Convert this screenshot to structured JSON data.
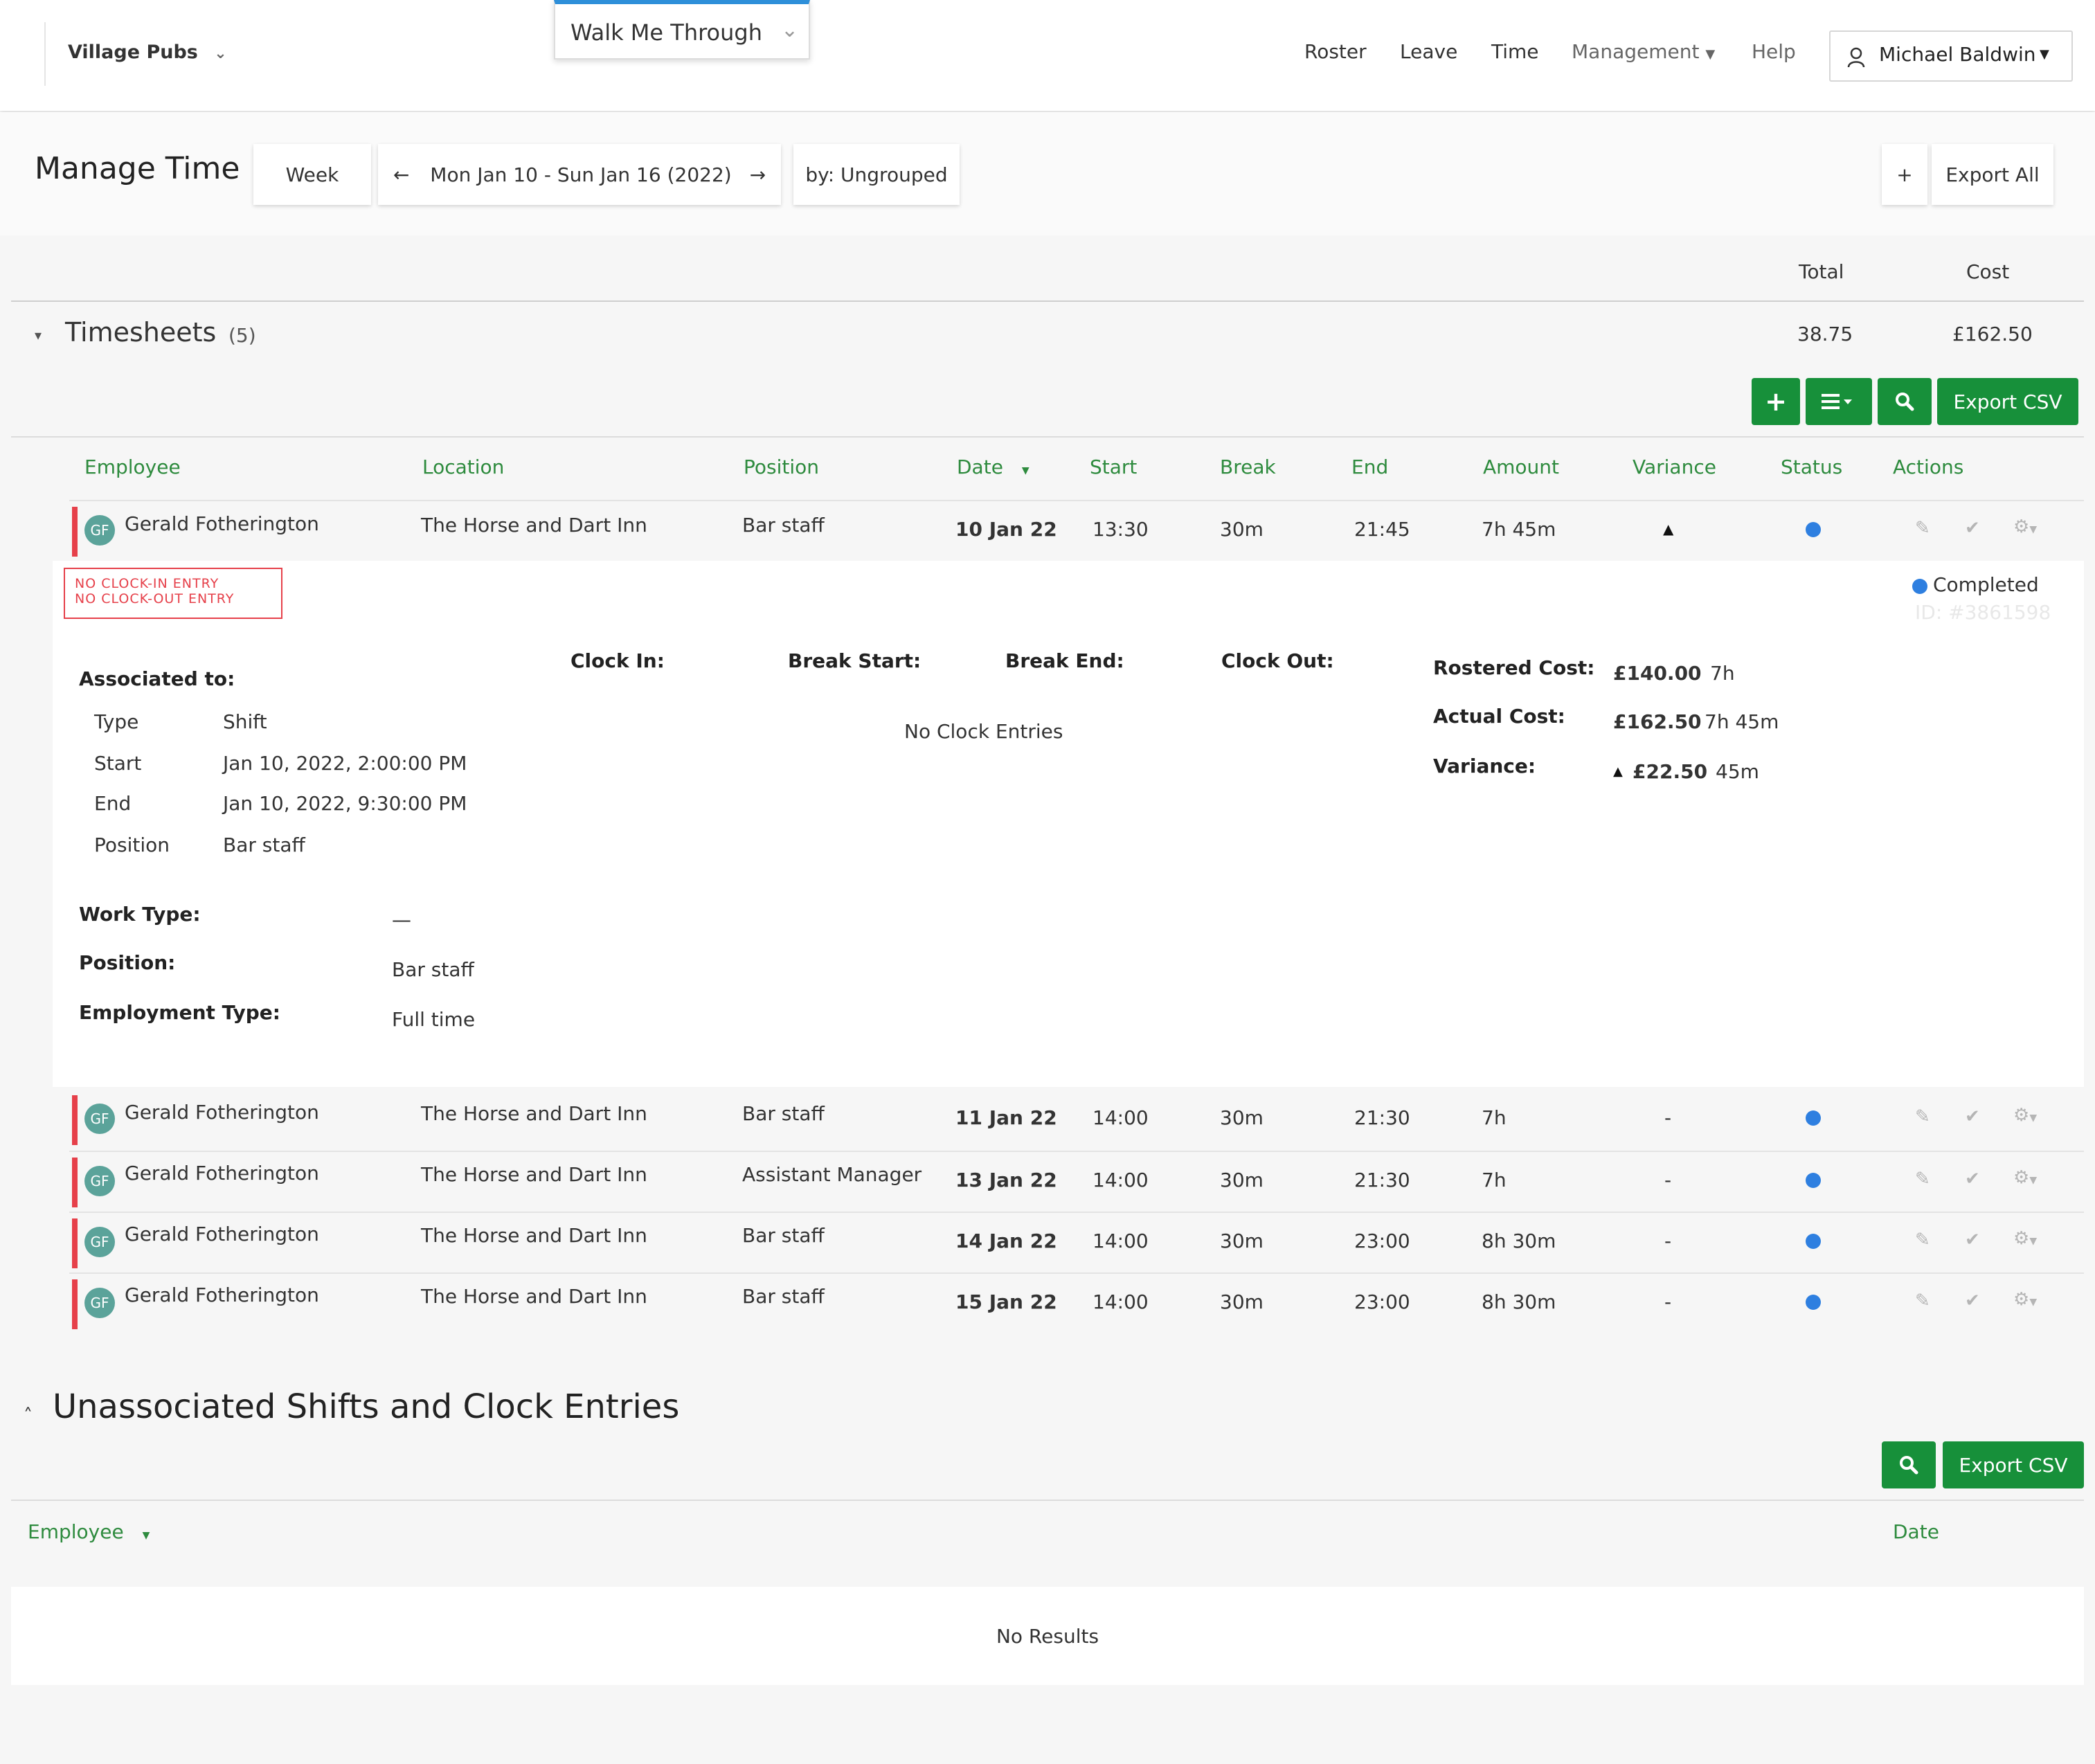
{
  "nav": {
    "org": "Village Pubs",
    "walkme": "Walk Me Through",
    "links": [
      "Roster",
      "Leave",
      "Time",
      "Management",
      "Help"
    ],
    "user": "Michael Baldwin"
  },
  "header": {
    "title": "Manage Time",
    "period": "Week",
    "range": "Mon Jan 10 - Sun Jan 16 (2022)",
    "grouping": "by: Ungrouped",
    "plus": "+",
    "export_all": "Export All"
  },
  "summary": {
    "total_label": "Total",
    "cost_label": "Cost",
    "section": "Timesheets",
    "count": "(5)",
    "total": "38.75",
    "cost": "£162.50"
  },
  "toolbar": {
    "export_csv": "Export CSV"
  },
  "columns": [
    "Employee",
    "Location",
    "Position",
    "Date",
    "Start",
    "Break",
    "End",
    "Amount",
    "Variance",
    "Status",
    "Actions"
  ],
  "rows": [
    {
      "initials": "GF",
      "employee": "Gerald Fotherington",
      "location": "The Horse and Dart Inn",
      "position": "Bar staff",
      "date": "10 Jan 22",
      "start": "13:30",
      "break": "30m",
      "end": "21:45",
      "amount": "7h 45m",
      "variance": "▲"
    },
    {
      "initials": "GF",
      "employee": "Gerald Fotherington",
      "location": "The Horse and Dart Inn",
      "position": "Bar staff",
      "date": "11 Jan 22",
      "start": "14:00",
      "break": "30m",
      "end": "21:30",
      "amount": "7h",
      "variance": "-"
    },
    {
      "initials": "GF",
      "employee": "Gerald Fotherington",
      "location": "The Horse and Dart Inn",
      "position": "Assistant Manager",
      "date": "13 Jan 22",
      "start": "14:00",
      "break": "30m",
      "end": "21:30",
      "amount": "7h",
      "variance": "-"
    },
    {
      "initials": "GF",
      "employee": "Gerald Fotherington",
      "location": "The Horse and Dart Inn",
      "position": "Bar staff",
      "date": "14 Jan 22",
      "start": "14:00",
      "break": "30m",
      "end": "23:00",
      "amount": "8h 30m",
      "variance": "-"
    },
    {
      "initials": "GF",
      "employee": "Gerald Fotherington",
      "location": "The Horse and Dart Inn",
      "position": "Bar staff",
      "date": "15 Jan 22",
      "start": "14:00",
      "break": "30m",
      "end": "23:00",
      "amount": "8h 30m",
      "variance": "-"
    }
  ],
  "detail": {
    "warning1": "NO CLOCK-IN ENTRY",
    "warning2": "NO CLOCK-OUT ENTRY",
    "status": "Completed",
    "id": "ID: #3861598",
    "associated_label": "Associated to:",
    "type_label": "Type",
    "type_value": "Shift",
    "start_label": "Start",
    "start_value": "Jan 10, 2022, 2:00:00 PM",
    "end_label": "End",
    "end_value": "Jan 10, 2022, 9:30:00 PM",
    "position_label": "Position",
    "position_value": "Bar staff",
    "clock_in": "Clock In:",
    "break_start": "Break Start:",
    "break_end": "Break End:",
    "clock_out": "Clock Out:",
    "no_clock": "No Clock Entries",
    "rostered_cost_label": "Rostered Cost:",
    "rostered_cost": "£140.00",
    "rostered_hours": "7h",
    "actual_cost_label": "Actual Cost:",
    "actual_cost": "£162.50",
    "actual_hours": "7h 45m",
    "variance_label": "Variance:",
    "variance_cost": "£22.50",
    "variance_hours": "45m",
    "work_type_label": "Work Type:",
    "work_type": "—",
    "position2_label": "Position:",
    "position2": "Bar staff",
    "employment_label": "Employment Type:",
    "employment": "Full time"
  },
  "unassoc": {
    "title": "Unassociated Shifts and Clock Entries",
    "export_csv": "Export CSV",
    "col_employee": "Employee",
    "col_date": "Date",
    "no_results": "No Results"
  },
  "colors": {
    "accent_green": "#17903a",
    "warning_red": "#e6404a",
    "status_blue": "#2e7fe0"
  }
}
